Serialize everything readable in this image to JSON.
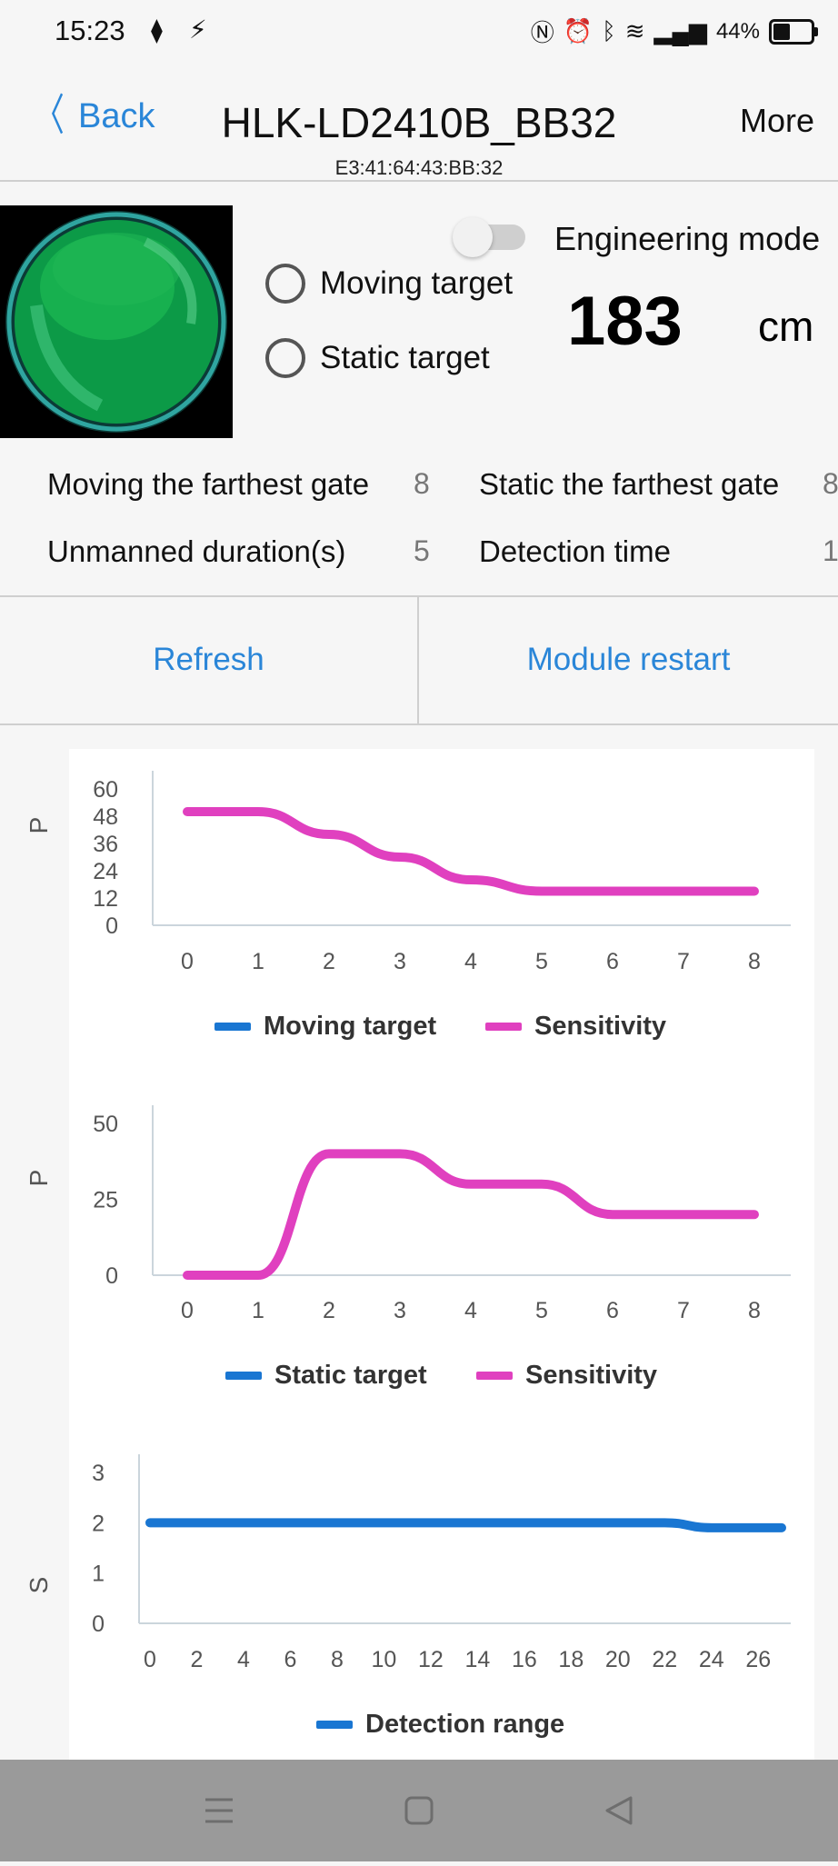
{
  "status": {
    "time": "15:23",
    "battery": "44%",
    "battery_level": 0.44,
    "icons": [
      "cloud-chevron-icon",
      "charging-bolt-icon",
      "nfc-icon",
      "alarm-icon",
      "bluetooth-icon",
      "wifi-icon",
      "signal-icon",
      "battery-icon"
    ]
  },
  "nav": {
    "back_label": "Back",
    "title": "HLK-LD2410B_BB32",
    "subtitle": "E3:41:64:43:BB:32",
    "more_label": "More"
  },
  "target": {
    "engineering_mode_label": "Engineering mode",
    "engineering_mode_on": false,
    "moving_label": "Moving target",
    "static_label": "Static target",
    "distance": "183",
    "distance_unit": "cm"
  },
  "settings": {
    "moving_gate_label": "Moving the farthest gate",
    "moving_gate_value": "8",
    "static_gate_label": "Static the farthest gate",
    "static_gate_value": "8",
    "unmanned_label": "Unmanned duration(s)",
    "unmanned_value": "5",
    "detection_time_label": "Detection time",
    "detection_time_value": "1"
  },
  "actions": {
    "refresh_label": "Refresh",
    "restart_label": "Module restart"
  },
  "colors": {
    "accent": "#2a86d8",
    "series_blue": "#1976d2",
    "series_magenta": "#e040bf"
  },
  "chart_data": [
    {
      "type": "line",
      "ylabel": "P",
      "ylim": [
        0,
        60
      ],
      "yticks": [
        "60",
        "48",
        "36",
        "24",
        "12",
        "0"
      ],
      "x": [
        0,
        1,
        2,
        3,
        4,
        5,
        6,
        7,
        8
      ],
      "xticks": [
        "0",
        "1",
        "2",
        "3",
        "4",
        "5",
        "6",
        "7",
        "8"
      ],
      "series": [
        {
          "name": "Moving target",
          "values": []
        },
        {
          "name": "Sensitivity",
          "values": [
            50,
            50,
            40,
            30,
            20,
            15,
            15,
            15,
            15
          ]
        }
      ],
      "legend": "bottom"
    },
    {
      "type": "line",
      "ylabel": "P",
      "ylim": [
        0,
        50
      ],
      "yticks": [
        "50",
        "25",
        "0"
      ],
      "x": [
        0,
        1,
        2,
        3,
        4,
        5,
        6,
        7,
        8
      ],
      "xticks": [
        "0",
        "1",
        "2",
        "3",
        "4",
        "5",
        "6",
        "7",
        "8"
      ],
      "series": [
        {
          "name": "Static target",
          "values": []
        },
        {
          "name": "Sensitivity",
          "values": [
            0,
            0,
            40,
            40,
            30,
            30,
            20,
            20,
            20
          ]
        }
      ],
      "legend": "bottom"
    },
    {
      "type": "line",
      "ylabel": "S",
      "ylim": [
        0,
        3
      ],
      "yticks": [
        "3",
        "2",
        "1",
        "0"
      ],
      "xlim": [
        0,
        27
      ],
      "xticks": [
        "0",
        "2",
        "4",
        "6",
        "8",
        "10",
        "12",
        "14",
        "16",
        "18",
        "20",
        "22",
        "24",
        "26"
      ],
      "series": [
        {
          "name": "Detection range",
          "x": [
            0,
            22,
            24,
            27
          ],
          "values": [
            2,
            2,
            1.9,
            1.9
          ]
        }
      ],
      "legend": "bottom"
    }
  ],
  "navbar": {
    "icons": [
      "menu-icon",
      "home-square-icon",
      "back-triangle-icon"
    ]
  }
}
